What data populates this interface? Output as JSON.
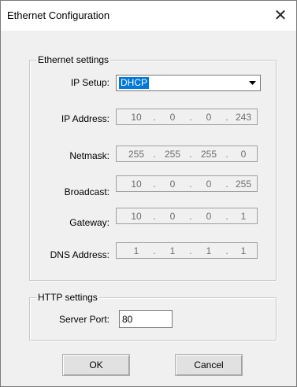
{
  "window": {
    "title": "Ethernet Configuration",
    "close_glyph": "✕"
  },
  "ethernet": {
    "legend": "Ethernet settings",
    "ip_setup": {
      "label": "IP Setup:",
      "value": "DHCP"
    },
    "ip_address": {
      "label": "IP Address:",
      "octets": [
        "10",
        "0",
        "0",
        "243"
      ]
    },
    "netmask": {
      "label": "Netmask:",
      "octets": [
        "255",
        "255",
        "255",
        "0"
      ]
    },
    "broadcast": {
      "label": "Broadcast:",
      "octets": [
        "10",
        "0",
        "0",
        "255"
      ]
    },
    "gateway": {
      "label": "Gateway:",
      "octets": [
        "10",
        "0",
        "0",
        "1"
      ]
    },
    "dns": {
      "label": "DNS Address:",
      "octets": [
        "1",
        "1",
        "1",
        "1"
      ]
    }
  },
  "http": {
    "legend": "HTTP settings",
    "server_port": {
      "label": "Server Port:",
      "value": "80"
    }
  },
  "buttons": {
    "ok": "OK",
    "cancel": "Cancel"
  },
  "icons": {
    "close": "close-icon",
    "dropdown": "chevron-down-icon"
  }
}
